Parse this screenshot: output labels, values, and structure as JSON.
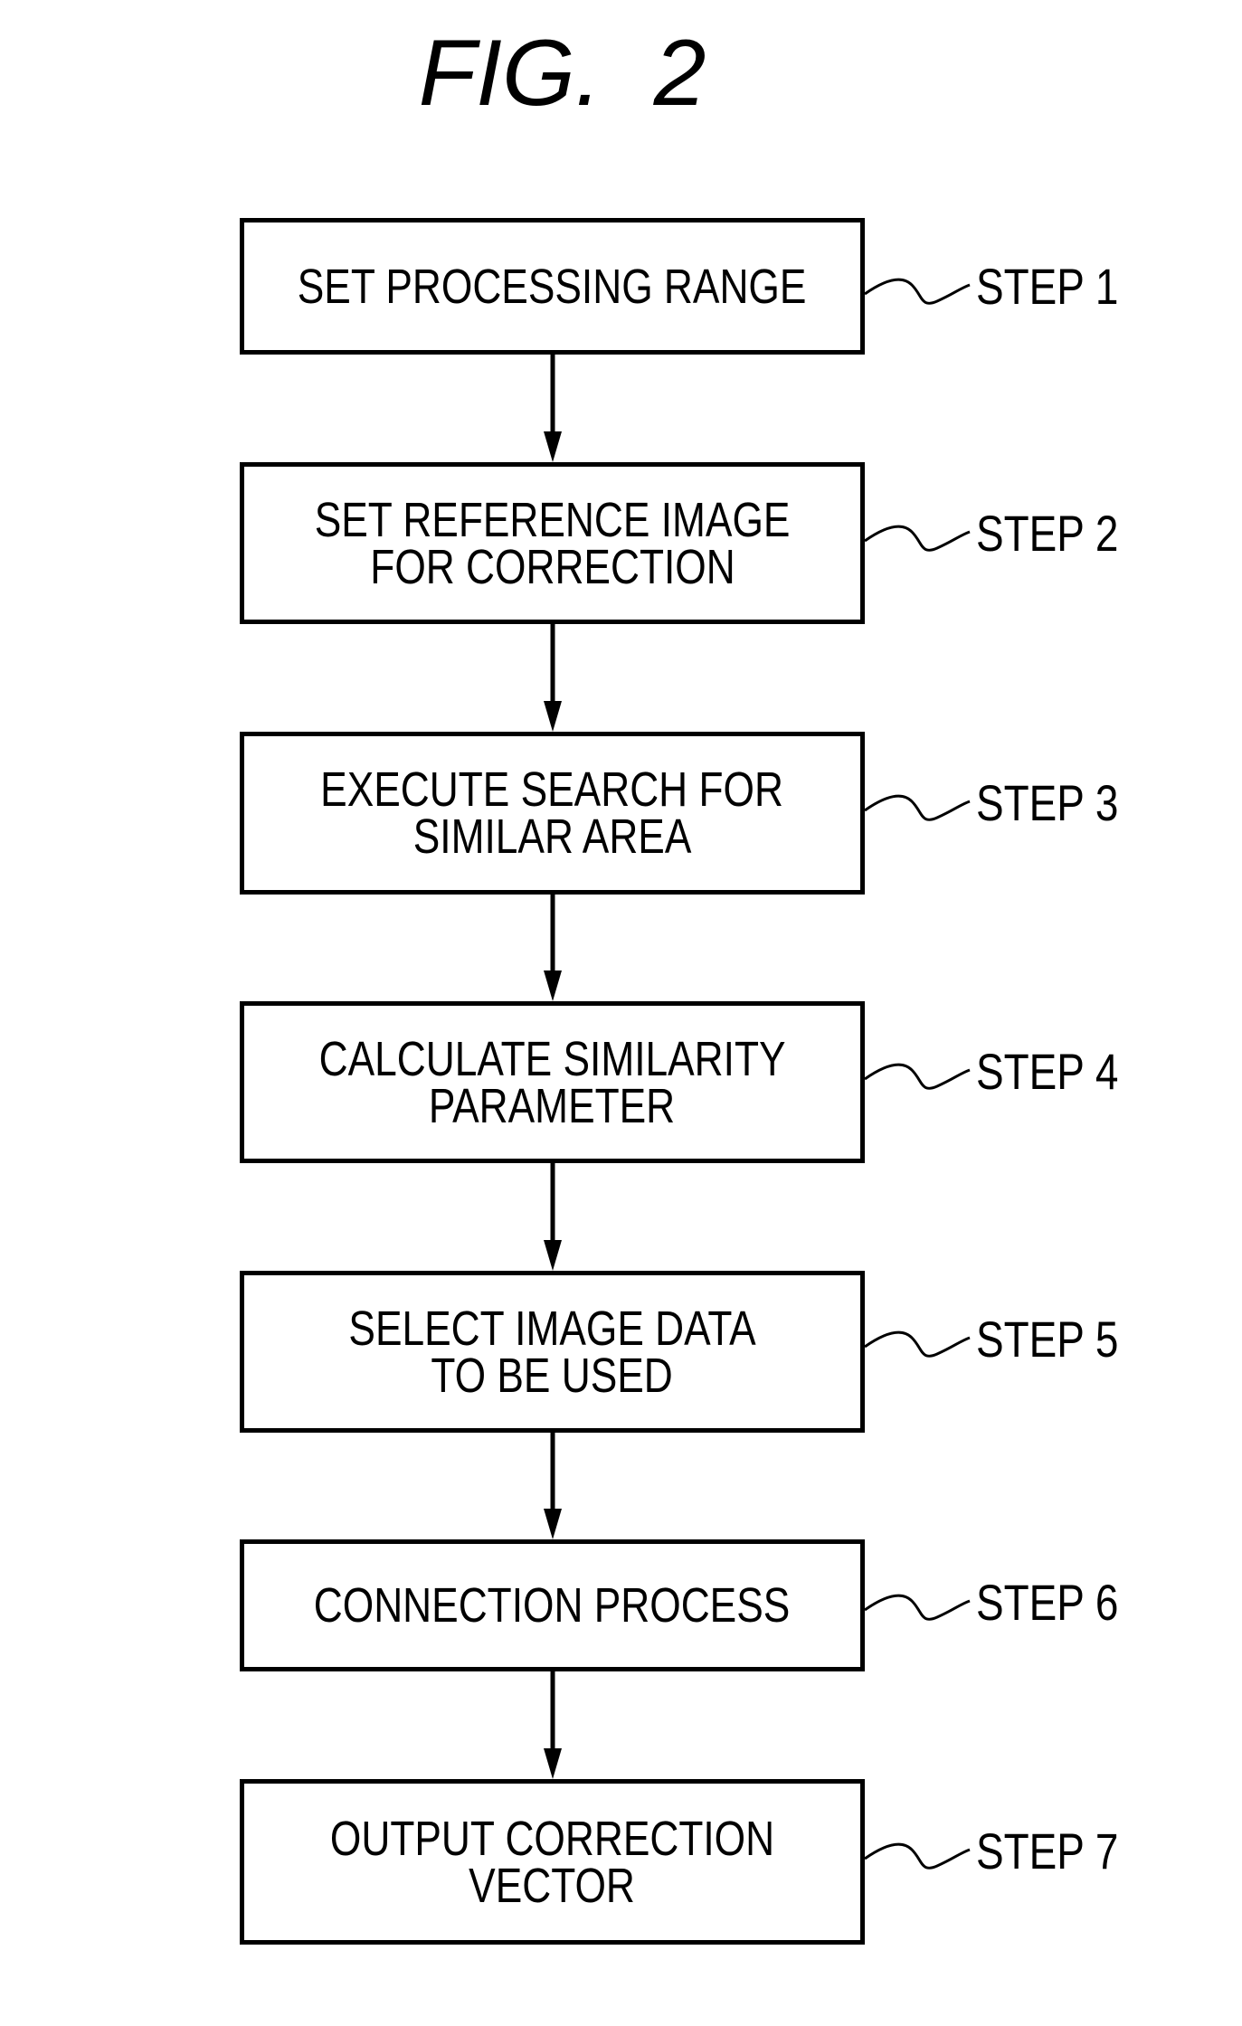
{
  "figure": {
    "title": "FIG.  2",
    "steps": [
      {
        "label": "STEP 1",
        "text_lines": [
          "SET PROCESSING RANGE"
        ]
      },
      {
        "label": "STEP 2",
        "text_lines": [
          "SET REFERENCE IMAGE",
          "FOR CORRECTION"
        ]
      },
      {
        "label": "STEP 3",
        "text_lines": [
          "EXECUTE SEARCH FOR",
          "SIMILAR AREA"
        ]
      },
      {
        "label": "STEP 4",
        "text_lines": [
          "CALCULATE SIMILARITY",
          "PARAMETER"
        ]
      },
      {
        "label": "STEP 5",
        "text_lines": [
          "SELECT IMAGE DATA",
          "TO BE USED"
        ]
      },
      {
        "label": "STEP 6",
        "text_lines": [
          "CONNECTION PROCESS"
        ]
      },
      {
        "label": "STEP 7",
        "text_lines": [
          "OUTPUT CORRECTION",
          "VECTOR"
        ]
      }
    ],
    "colors": {
      "line": "#000000",
      "background": "#ffffff"
    }
  }
}
